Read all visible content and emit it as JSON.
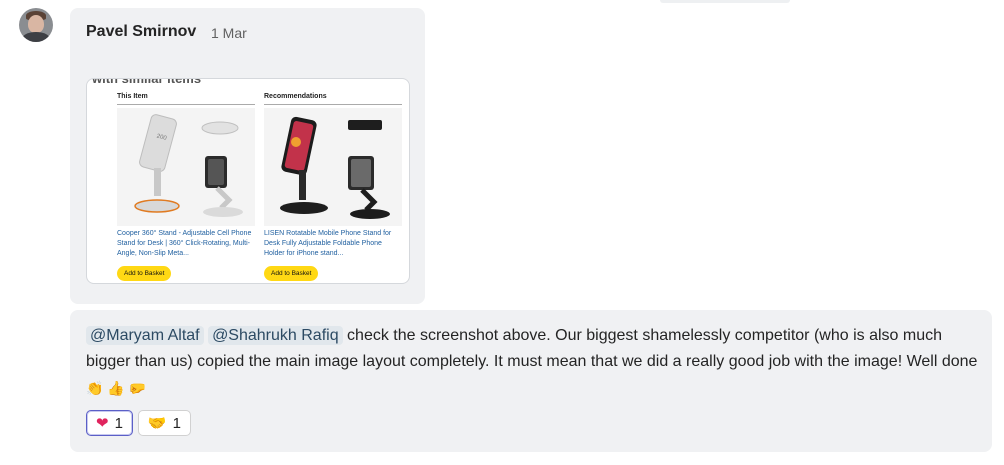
{
  "message1": {
    "author": "Pavel Smirnov",
    "date": "1 Mar",
    "screenshot": {
      "heading": "with similar items",
      "left": {
        "title": "This Item",
        "description": "Cooper 360° Stand - Adjustable Cell Phone Stand for Desk | 360° Click-Rotating, Multi-Angle, Non-Slip Meta...",
        "button": "Add to Basket"
      },
      "right": {
        "title": "Recommendations",
        "description": "LISEN Rotatable Mobile Phone Stand for Desk Fully Adjustable Foldable Phone Holder for iPhone stand...",
        "button": "Add to Basket"
      }
    }
  },
  "message2": {
    "mention1": "@Maryam Altaf",
    "mention2": "@Shahrukh Rafiq",
    "text": " check the screenshot above. Our biggest shamelessly competitor (who is also much bigger than us) copied the main image layout completely. It must mean that we did a really good job with the image! Well done ",
    "emojis": "👏 👍 🤛",
    "reactions": [
      {
        "icon": "heart-icon",
        "count": "1"
      },
      {
        "icon": "handshake-icon",
        "count": "1"
      }
    ]
  }
}
